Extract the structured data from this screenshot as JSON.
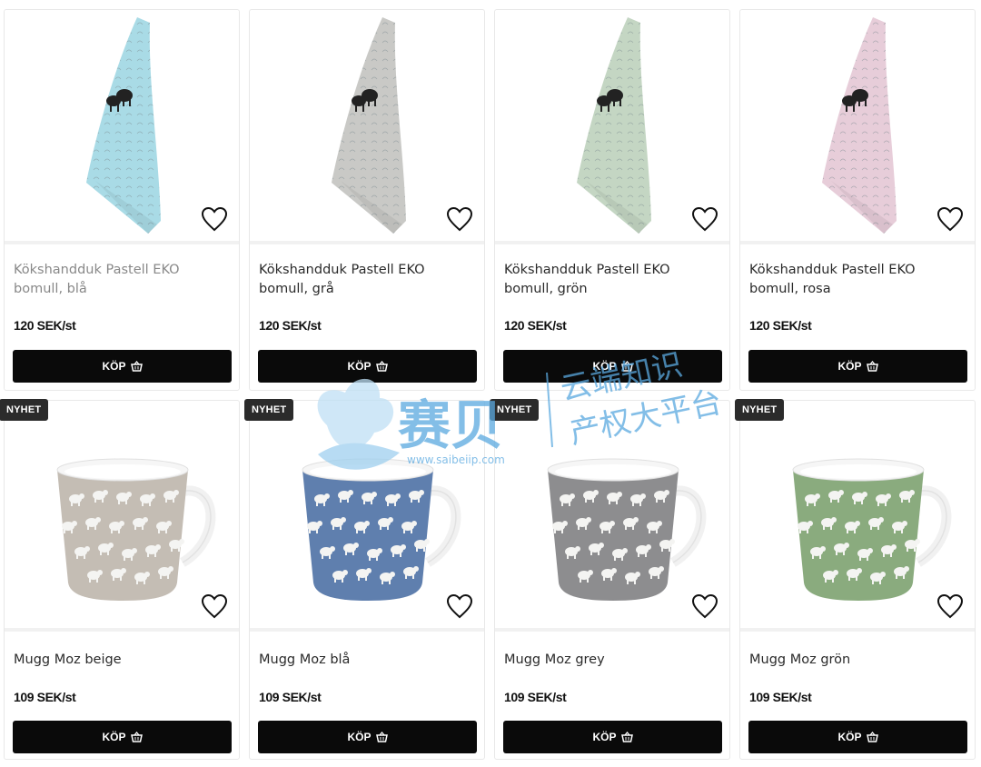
{
  "products": [
    {
      "name": "Kökshandduk Pastell EKO bomull, blå",
      "price": "120 SEK/st",
      "buy_label": "KÖP",
      "badge": "",
      "kind": "towel",
      "color": "#a9dbe6",
      "muted": true
    },
    {
      "name": "Kökshandduk Pastell EKO bomull, grå",
      "price": "120 SEK/st",
      "buy_label": "KÖP",
      "badge": "",
      "kind": "towel",
      "color": "#c9c9c6",
      "muted": false
    },
    {
      "name": "Kökshandduk Pastell EKO bomull, grön",
      "price": "120 SEK/st",
      "buy_label": "KÖP",
      "badge": "",
      "kind": "towel",
      "color": "#c4d6c3",
      "muted": false
    },
    {
      "name": "Kökshandduk Pastell EKO bomull, rosa",
      "price": "120 SEK/st",
      "buy_label": "KÖP",
      "badge": "",
      "kind": "towel",
      "color": "#e7cdd9",
      "muted": false
    },
    {
      "name": "Mugg Moz beige",
      "price": "109 SEK/st",
      "buy_label": "KÖP",
      "badge": "NYHET",
      "kind": "mug",
      "color": "#c4bdb4",
      "muted": false
    },
    {
      "name": "Mugg Moz blå",
      "price": "109 SEK/st",
      "buy_label": "KÖP",
      "badge": "NYHET",
      "kind": "mug",
      "color": "#5f7fae",
      "muted": false
    },
    {
      "name": "Mugg Moz grey",
      "price": "109 SEK/st",
      "buy_label": "KÖP",
      "badge": "NYHET",
      "kind": "mug",
      "color": "#8d8d8f",
      "muted": false
    },
    {
      "name": "Mugg Moz grön",
      "price": "109 SEK/st",
      "buy_label": "KÖP",
      "badge": "NYHET",
      "kind": "mug",
      "color": "#8aab7e",
      "muted": false
    }
  ],
  "watermark": {
    "brand": "赛贝",
    "url": "www.saibeiip.com",
    "line1": "云端知识",
    "line2": "产权大平台",
    "color": "#5aa9e0"
  }
}
